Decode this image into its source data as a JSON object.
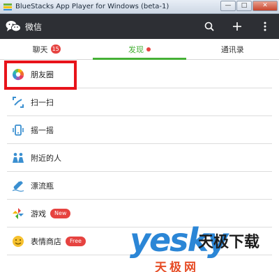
{
  "window": {
    "title": "BlueStacks App Player for Windows (beta-1)",
    "minimize": "—",
    "maximize": "□",
    "close": "✕"
  },
  "actionbar": {
    "app_name": "微信",
    "icons": [
      "search-icon",
      "plus-icon",
      "more-vertical-icon"
    ]
  },
  "tabs": [
    {
      "label": "聊天",
      "badge": "15",
      "active": false
    },
    {
      "label": "发现",
      "dot": true,
      "active": true
    },
    {
      "label": "通讯录",
      "active": false
    }
  ],
  "list": [
    {
      "label": "朋友圈",
      "icon": "moments-icon",
      "highlighted": true
    },
    {
      "label": "扫一扫",
      "icon": "scan-icon"
    },
    {
      "label": "摇一摇",
      "icon": "shake-icon"
    },
    {
      "label": "附近的人",
      "icon": "people-nearby-icon"
    },
    {
      "label": "漂流瓶",
      "icon": "drift-bottle-icon"
    },
    {
      "label": "游戏",
      "icon": "games-icon",
      "badge": "New"
    },
    {
      "label": "表情商店",
      "icon": "sticker-shop-icon",
      "badge": "Free"
    }
  ],
  "watermark": {
    "brand": "yesky",
    "text": "天极下载",
    "sub": "天极网"
  },
  "colors": {
    "accent_green": "#45b035",
    "badge_red": "#e64340",
    "actionbar": "#2d2f34",
    "highlight_red": "#e8131a"
  }
}
